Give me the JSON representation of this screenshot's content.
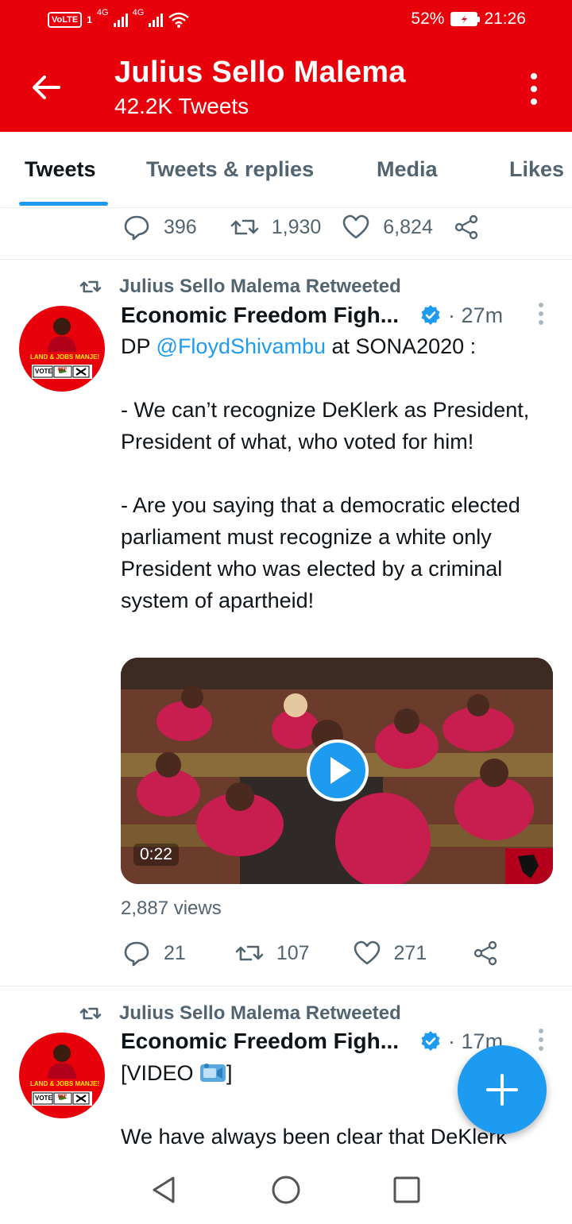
{
  "status_bar": {
    "carrier_badge": "VoLTE",
    "sim": "1",
    "net1": "4G",
    "net2": "4G",
    "battery": "52%",
    "time": "21:26"
  },
  "header": {
    "title": "Julius Sello Malema",
    "subtitle": "42.2K Tweets"
  },
  "tabs": [
    {
      "label": "Tweets",
      "active": true
    },
    {
      "label": "Tweets & replies",
      "active": false
    },
    {
      "label": "Media",
      "active": false
    },
    {
      "label": "Likes",
      "active": false
    }
  ],
  "prev_tweet": {
    "replies": "396",
    "retweets": "1,930",
    "likes": "6,824"
  },
  "tweets": [
    {
      "retweet_label": "Julius Sello Malema Retweeted",
      "author": "Economic Freedom Figh...",
      "time": "· 27m",
      "text_pre": "DP ",
      "mention": "@FloydShivambu",
      "text_post": " at SONA2020 :",
      "body": "- We can’t recognize DeKlerk as President, President of what, who voted for him!\n\n- Are  you saying that a democratic elected parliament must recognize a white only President who was elected by a criminal system of apartheid!",
      "video_duration": "0:22",
      "views": "2,887 views",
      "replies": "21",
      "retweets": "107",
      "likes": "271"
    },
    {
      "retweet_label": "Julius Sello Malema Retweeted",
      "author": "Economic Freedom Figh...",
      "time": "· 17m",
      "line1_pre": "[VIDEO ",
      "line1_post": "]",
      "body": "We have always been clear that DeKlerk"
    }
  ],
  "avatar_text": {
    "line1": "LAND & JOBS MANJE!",
    "vote": "VOTE",
    "eff": "EFF"
  },
  "colors": {
    "brand_red": "#e8000b",
    "twitter_blue": "#1d9bf0",
    "muted": "#536471"
  }
}
